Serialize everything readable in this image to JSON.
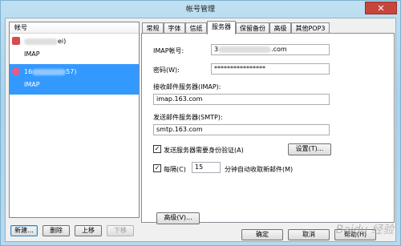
{
  "window": {
    "title": "帐号管理",
    "close_glyph": "✕"
  },
  "accounts": {
    "header": "帐号",
    "items": [
      {
        "name_suffix": "ei)",
        "type": "IMAP",
        "selected": false
      },
      {
        "name_prefix": "16",
        "name_suffix": "57)",
        "type": "IMAP",
        "selected": true
      }
    ],
    "buttons": {
      "new": "新建...",
      "delete": "删除",
      "up": "上移",
      "down": "下移"
    }
  },
  "tabs": [
    "常规",
    "字体",
    "信纸",
    "服务器",
    "保留备份",
    "高级",
    "其他POP3"
  ],
  "active_tab": "服务器",
  "server": {
    "imap_account_label": "IMAP帐号:",
    "imap_account_value_start": "3",
    "imap_account_value_end": ".com",
    "password_label": "密码(W):",
    "password_value": "****************",
    "imap_server_label": "接收邮件服务器(IMAP):",
    "imap_server_value": "imap.163.com",
    "smtp_server_label": "发送邮件服务器(SMTP):",
    "smtp_server_value": "smtp.163.com",
    "smtp_auth_label": "发送服务器需要身份验证(A)",
    "settings_button": "设置(T)...",
    "every_label": "每隔(C)",
    "every_value": "15",
    "every_suffix": "分钟自动收取新邮件(M)",
    "advanced_button": "高级(V)..."
  },
  "footer": {
    "ok": "确定",
    "cancel": "取消",
    "help": "帮助(H)"
  },
  "watermark": "Baidu 经验"
}
